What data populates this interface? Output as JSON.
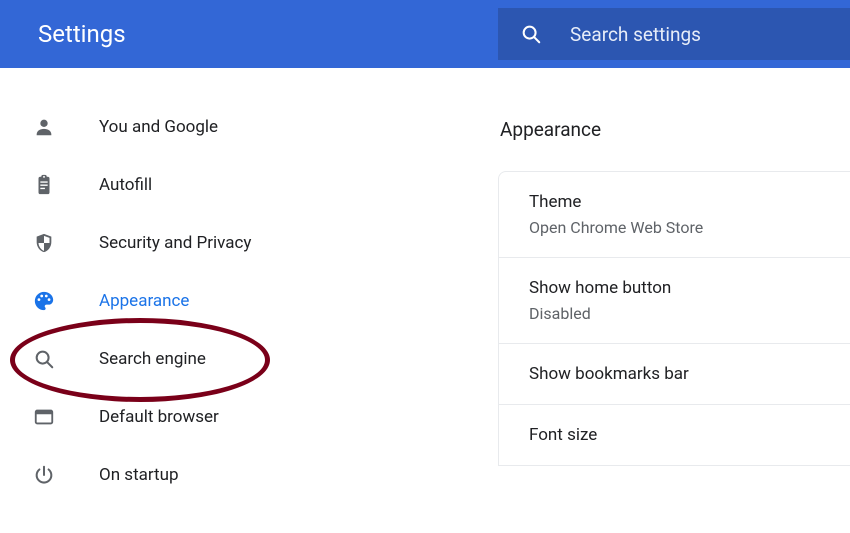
{
  "header": {
    "title": "Settings",
    "search_placeholder": "Search settings"
  },
  "sidebar": {
    "items": [
      {
        "id": "you",
        "label": "You and Google",
        "active": false
      },
      {
        "id": "autofill",
        "label": "Autofill",
        "active": false
      },
      {
        "id": "security",
        "label": "Security and Privacy",
        "active": false
      },
      {
        "id": "appearance",
        "label": "Appearance",
        "active": true
      },
      {
        "id": "search",
        "label": "Search engine",
        "active": false
      },
      {
        "id": "default",
        "label": "Default browser",
        "active": false
      },
      {
        "id": "startup",
        "label": "On startup",
        "active": false
      }
    ]
  },
  "main": {
    "section_title": "Appearance",
    "rows": [
      {
        "title": "Theme",
        "sub": "Open Chrome Web Store"
      },
      {
        "title": "Show home button",
        "sub": "Disabled"
      },
      {
        "title": "Show bookmarks bar",
        "sub": ""
      },
      {
        "title": "Font size",
        "sub": ""
      }
    ]
  }
}
